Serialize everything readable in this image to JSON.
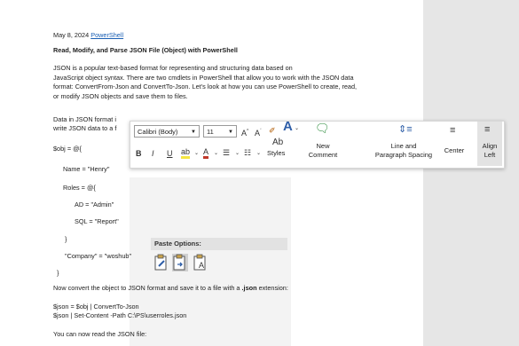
{
  "doc": {
    "date": "May 8, 2024",
    "date_link": "PowerShell",
    "heading": "Read, Modify, and Parse JSON File (Object) with PowerShell",
    "para1": [
      "JSON is a popular text-based format for representing and structuring data based on",
      "JavaScript object syntax. There are two cmdlets in PowerShell that allow you to work with the JSON data",
      "format: ConvertFrom-Json and ConvertTo-Json. Let's look at how you can use PowerShell to create, read,",
      "or modify JSON objects and save them to files."
    ],
    "para2_start": "Data in JSON format i",
    "para2_end": "write JSON data to a f",
    "code": {
      "l1": "$obj = @{",
      "l2": "Name = \"Henry\"",
      "l3": "Roles = @{",
      "l4": "AD = \"Admin\"",
      "l5": "SQL = \"Report\"",
      "l6": "}",
      "l7": "\"Company\" = \"woshub\"",
      "l8": "}"
    },
    "convert_text_a": "Now convert the object to JSON format and save it to a file with a ",
    "convert_text_b": ".json",
    "convert_text_c": " extension:",
    "cmd1": "$json = $obj | ConvertTo-Json",
    "cmd2": "$json | Set-Content -Path C:\\PS\\userroles.json",
    "read_text": "You can now read the JSON file:"
  },
  "toolbar": {
    "font_name": "Calibri (Body)",
    "font_size": "11",
    "styles_label": "Styles",
    "new_comment_label_1": "New",
    "new_comment_label_2": "Comment",
    "line_spacing_label_1": "Line and",
    "line_spacing_label_2": "Paragraph Spacing",
    "center_label": "Center",
    "align_left_label_1": "Align",
    "align_left_label_2": "Left",
    "bold": "B",
    "italic": "I",
    "underline": "U"
  },
  "paste": {
    "title": "Paste Options:"
  },
  "colors": {
    "link": "#1a5fb4",
    "highlight": "#f5e642",
    "font_color": "#c0392b",
    "selected": "#e3e3e3"
  }
}
